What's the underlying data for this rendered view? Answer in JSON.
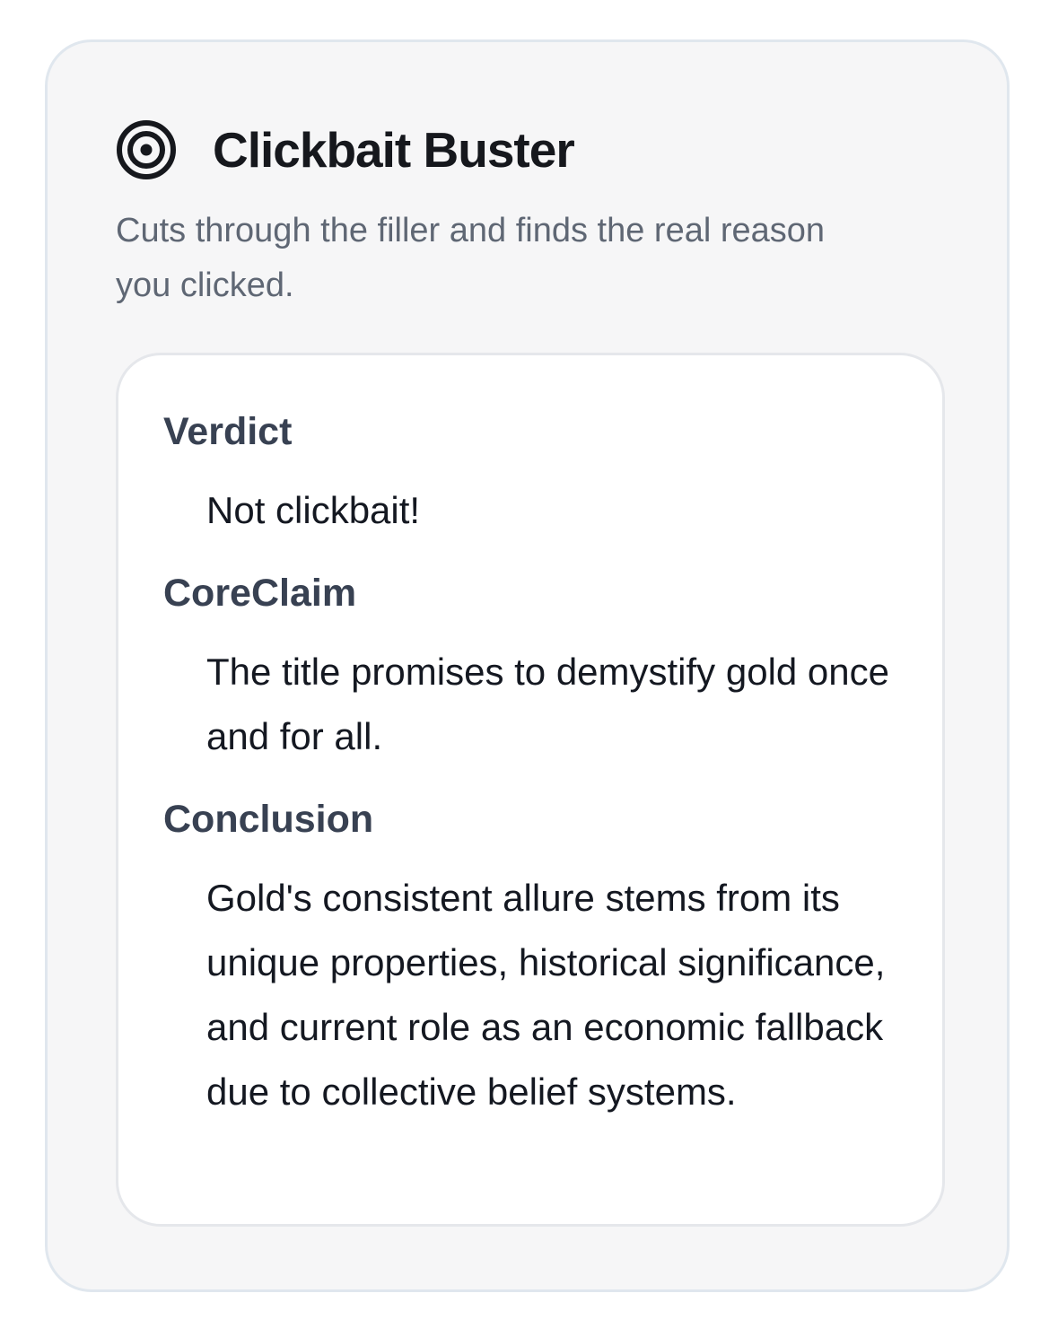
{
  "app": {
    "icon": "target-icon",
    "title": "Clickbait Buster",
    "subtitle": "Cuts through the filler and finds the real reason you clicked."
  },
  "result": {
    "verdict": {
      "label": "Verdict",
      "value": "Not clickbait!"
    },
    "core_claim": {
      "label": "CoreClaim",
      "value": "The title promises to demystify gold once and for all."
    },
    "conclusion": {
      "label": "Conclusion",
      "value": "Gold's consistent allure stems from its unique properties, historical significance, and current role as an economic fallback due to collective belief systems."
    }
  },
  "colors": {
    "card_background": "#f6f6f7",
    "card_border": "#e0e7ee",
    "title_text": "#16181d",
    "subtitle_text": "#5f6774",
    "label_text": "#384152",
    "value_text": "#141821"
  }
}
